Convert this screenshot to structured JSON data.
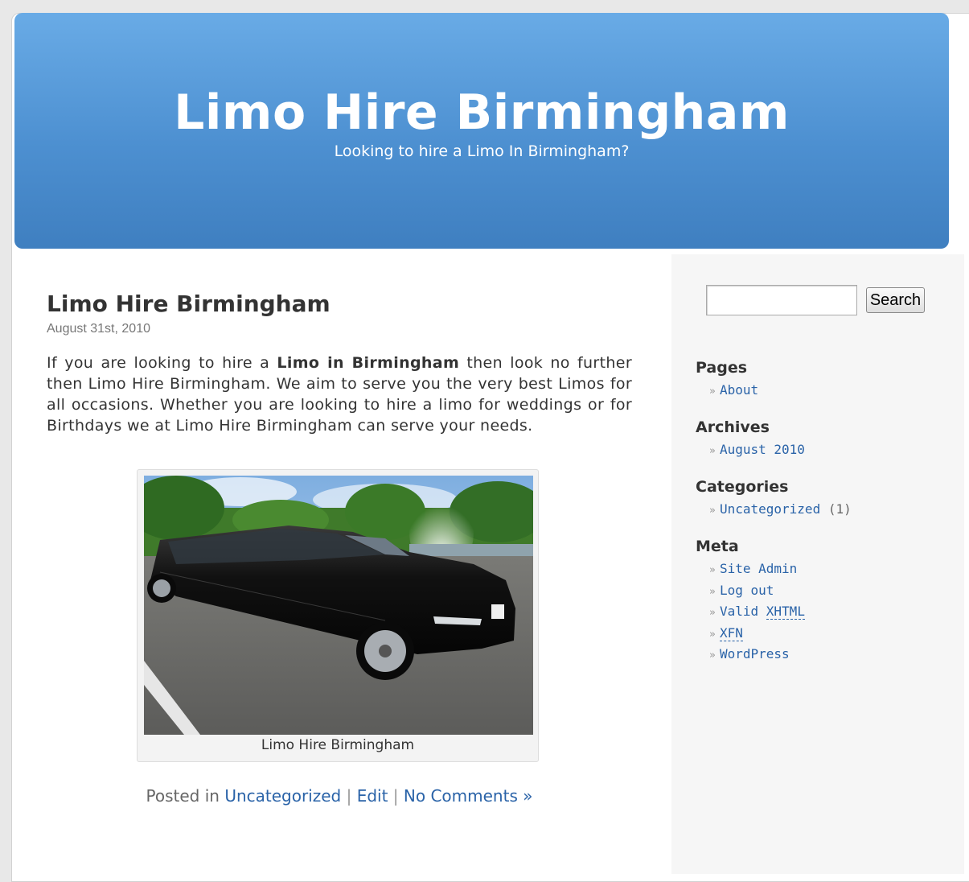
{
  "header": {
    "title": "Limo Hire Birmingham",
    "description": "Looking to hire a Limo In Birmingham?"
  },
  "post": {
    "title": "Limo Hire Birmingham",
    "date": "August 31st, 2010",
    "body_prefix": "If you are looking to hire a",
    "body_bold": "Limo in Birmingham",
    "body_suffix": "then look no further then Limo Hire Birmingham. We aim to serve you the very best Limos for all occasions. Whether you are looking to hire a limo for weddings or for Birthdays we at Limo Hire Birmingham can serve your needs.",
    "image_caption": "Limo Hire Birmingham",
    "meta": {
      "posted_in": "Posted in",
      "category": "Uncategorized",
      "separator": "|",
      "edit": "Edit",
      "comments": "No Comments »"
    }
  },
  "sidebar": {
    "search": {
      "value": "",
      "button_label": "Search"
    },
    "pages": {
      "heading": "Pages",
      "items": [
        {
          "label": "About"
        }
      ]
    },
    "archives": {
      "heading": "Archives",
      "items": [
        {
          "label": "August 2010"
        }
      ]
    },
    "categories": {
      "heading": "Categories",
      "items": [
        {
          "label": "Uncategorized",
          "count": "(1)"
        }
      ]
    },
    "meta": {
      "heading": "Meta",
      "items": [
        {
          "label": "Site Admin"
        },
        {
          "label": "Log out"
        },
        {
          "label_prefix": "Valid",
          "label_abbr": "XHTML"
        },
        {
          "label_abbr": "XFN"
        },
        {
          "label": "WordPress"
        }
      ]
    },
    "bullet": "»"
  },
  "colors": {
    "header_top": "#69abe6",
    "header_bottom": "#3f7fc0",
    "link": "#2a63a8",
    "sidebar_bg": "#f6f6f6"
  }
}
